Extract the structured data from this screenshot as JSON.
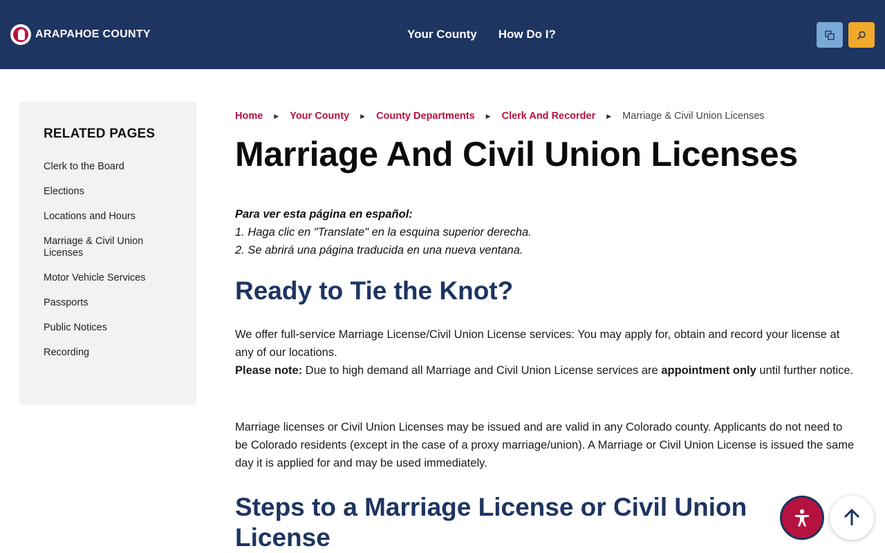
{
  "header": {
    "logo_text": "ARAPAHOE COUNTY",
    "nav": [
      "Your County",
      "How Do I?"
    ],
    "translate_icon": "translate-icon",
    "search_icon": "search-icon",
    "colors": {
      "bar": "#1e3461",
      "translate_btn": "#79a9d6",
      "search_btn": "#f0a92a"
    }
  },
  "sidebar": {
    "title": "RELATED PAGES",
    "items": [
      "Clerk to the Board",
      "Elections",
      "Locations and Hours",
      "Marriage & Civil Union Licenses",
      "Motor Vehicle Services",
      "Passports",
      "Public Notices",
      "Recording"
    ]
  },
  "breadcrumb": {
    "links": [
      "Home",
      "Your County",
      "County Departments",
      "Clerk And Recorder"
    ],
    "current": "Marriage & Civil Union Licenses"
  },
  "page": {
    "title": "Marriage And Civil Union Licenses",
    "spanish": {
      "lead": "Para ver esta página en español:",
      "line1": "1. Haga clic en \"Translate\" en la esquina superior derecha.",
      "line2": "2. Se abrirá una página traducida en una nueva ventana."
    },
    "section1_heading": "Ready to Tie the Knot?",
    "p1_text": "We offer full-service Marriage License/Civil Union License services: You may apply for, obtain and record your license at any of our locations.",
    "p1_note_label": "Please note:",
    "p1_note_text": " Due to high demand all Marriage and Civil Union License services are ",
    "p1_note_bold": "appointment only",
    "p1_note_end": " until further notice.",
    "p2_text": "Marriage licenses or Civil Union Licenses may be issued and are valid in any Colorado county. Applicants do not need to be Colorado residents (except in the case of a proxy marriage/union). A Marriage or Civil Union License is issued the same day it is applied for and may be used immediately.",
    "section2_heading": "Steps to a Marriage License or Civil Union License"
  },
  "floating": {
    "accessibility_icon": "accessibility-icon",
    "back_to_top_icon": "arrow-up-icon"
  },
  "accent_color": "#b5123f"
}
